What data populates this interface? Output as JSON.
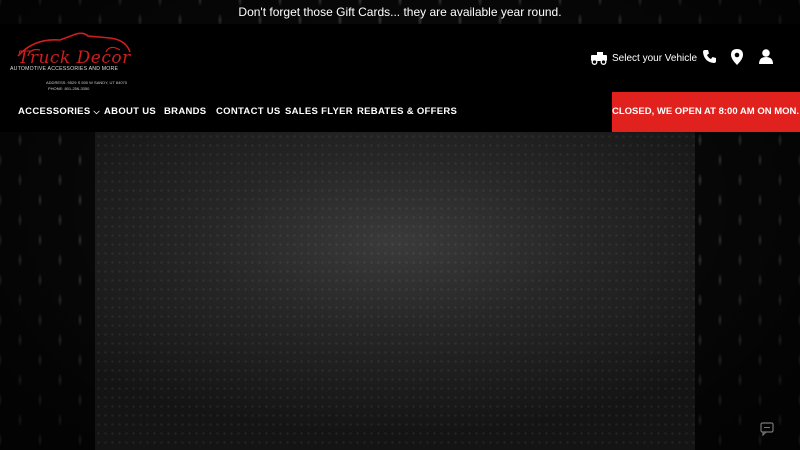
{
  "announcement": "Don't forget those Gift Cards... they are available year round.",
  "logo": {
    "brand": "Truck Decor",
    "tagline": "AUTOMOTIVE ACCESSORIES AND MORE",
    "address": "ADDRESS: 9529 S 500 W SANDY, UT 84070",
    "phone": "PHONE: 801-256-3350"
  },
  "header": {
    "vehicle_label": "Select your Vehicle",
    "icons": [
      "phone-icon",
      "location-icon",
      "account-icon"
    ]
  },
  "nav": {
    "items": [
      {
        "label": "ACCESSORIES",
        "has_dropdown": true
      },
      {
        "label": "ABOUT US"
      },
      {
        "label": "BRANDS"
      },
      {
        "label": "CONTACT US"
      },
      {
        "label": "SALES FLYER"
      },
      {
        "label": "REBATES & OFFERS"
      }
    ],
    "hours_status": "CLOSED, WE OPEN AT 8:00 AM ON MON."
  },
  "colors": {
    "accent": "#e0211e",
    "brand_red": "#d11d1d",
    "header_bg": "#000000"
  }
}
